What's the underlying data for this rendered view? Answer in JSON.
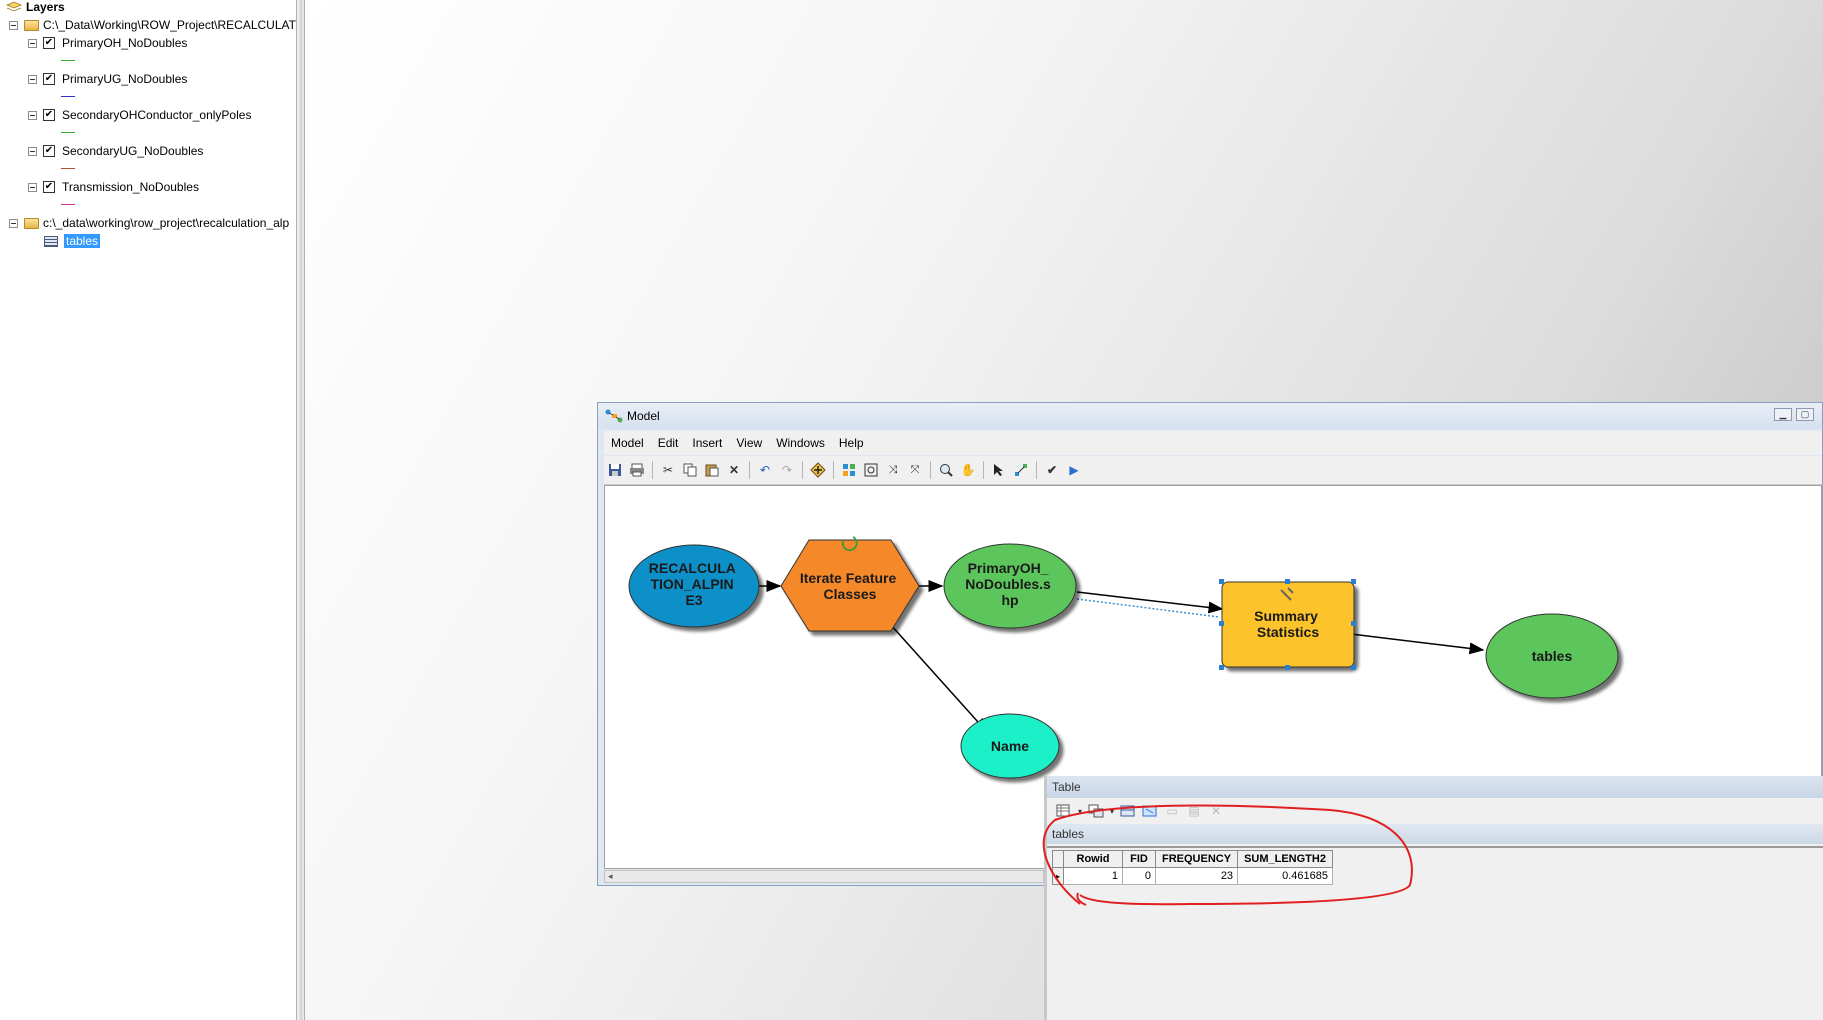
{
  "toc": {
    "title": "Layers",
    "groups": [
      {
        "path": "C:\\_Data\\Working\\ROW_Project\\RECALCULATI",
        "layers": [
          {
            "name": "PrimaryOH_NoDoubles",
            "checked": true,
            "symbol_color": "#33b233"
          },
          {
            "name": "PrimaryUG_NoDoubles",
            "checked": true,
            "symbol_color": "#3333cc"
          },
          {
            "name": "SecondaryOHConductor_onlyPoles",
            "checked": true,
            "symbol_color": "#33aa33"
          },
          {
            "name": "SecondaryUG_NoDoubles",
            "checked": true,
            "symbol_color": "#aa5533"
          },
          {
            "name": "Transmission_NoDoubles",
            "checked": true,
            "symbol_color": "#cc3399"
          }
        ]
      },
      {
        "path": "c:\\_data\\working\\row_project\\recalculation_alp",
        "tables": [
          "tables"
        ]
      }
    ]
  },
  "model_window": {
    "title": "Model",
    "menu": [
      "Model",
      "Edit",
      "Insert",
      "View",
      "Windows",
      "Help"
    ],
    "toolbar_icons": [
      "save-icon",
      "print-icon",
      "cut-icon",
      "copy-icon",
      "paste-icon",
      "delete-icon",
      "undo-icon",
      "redo-icon",
      "add-data-icon",
      "auto-layout-icon",
      "full-extent-icon",
      "zoom-in-fixed-icon",
      "zoom-out-fixed-icon",
      "zoom-icon",
      "pan-icon",
      "select-icon",
      "connect-icon",
      "validate-icon",
      "run-icon"
    ],
    "nodes": {
      "input": "RECALCULA TION_ALPIN E3",
      "iterator": "Iterate Feature Classes",
      "feature_output": "PrimaryOH_ NoDoubles.s hp",
      "name_output": "Name",
      "tool": "Summary Statistics",
      "table_output": "tables"
    },
    "colors": {
      "input": "#0a8fc8",
      "iterator": "#f5892b",
      "feature_output": "#5cc65c",
      "name_output": "#1ff0c8",
      "tool": "#fdc32c",
      "table_output": "#5cc65c"
    }
  },
  "table_window": {
    "title": "Table",
    "tab": "tables",
    "columns": [
      "Rowid",
      "FID",
      "FREQUENCY",
      "SUM_LENGTH2"
    ],
    "rows": [
      [
        "1",
        "0",
        "23",
        "0.461685"
      ]
    ],
    "annotation_color": "#e02020"
  }
}
